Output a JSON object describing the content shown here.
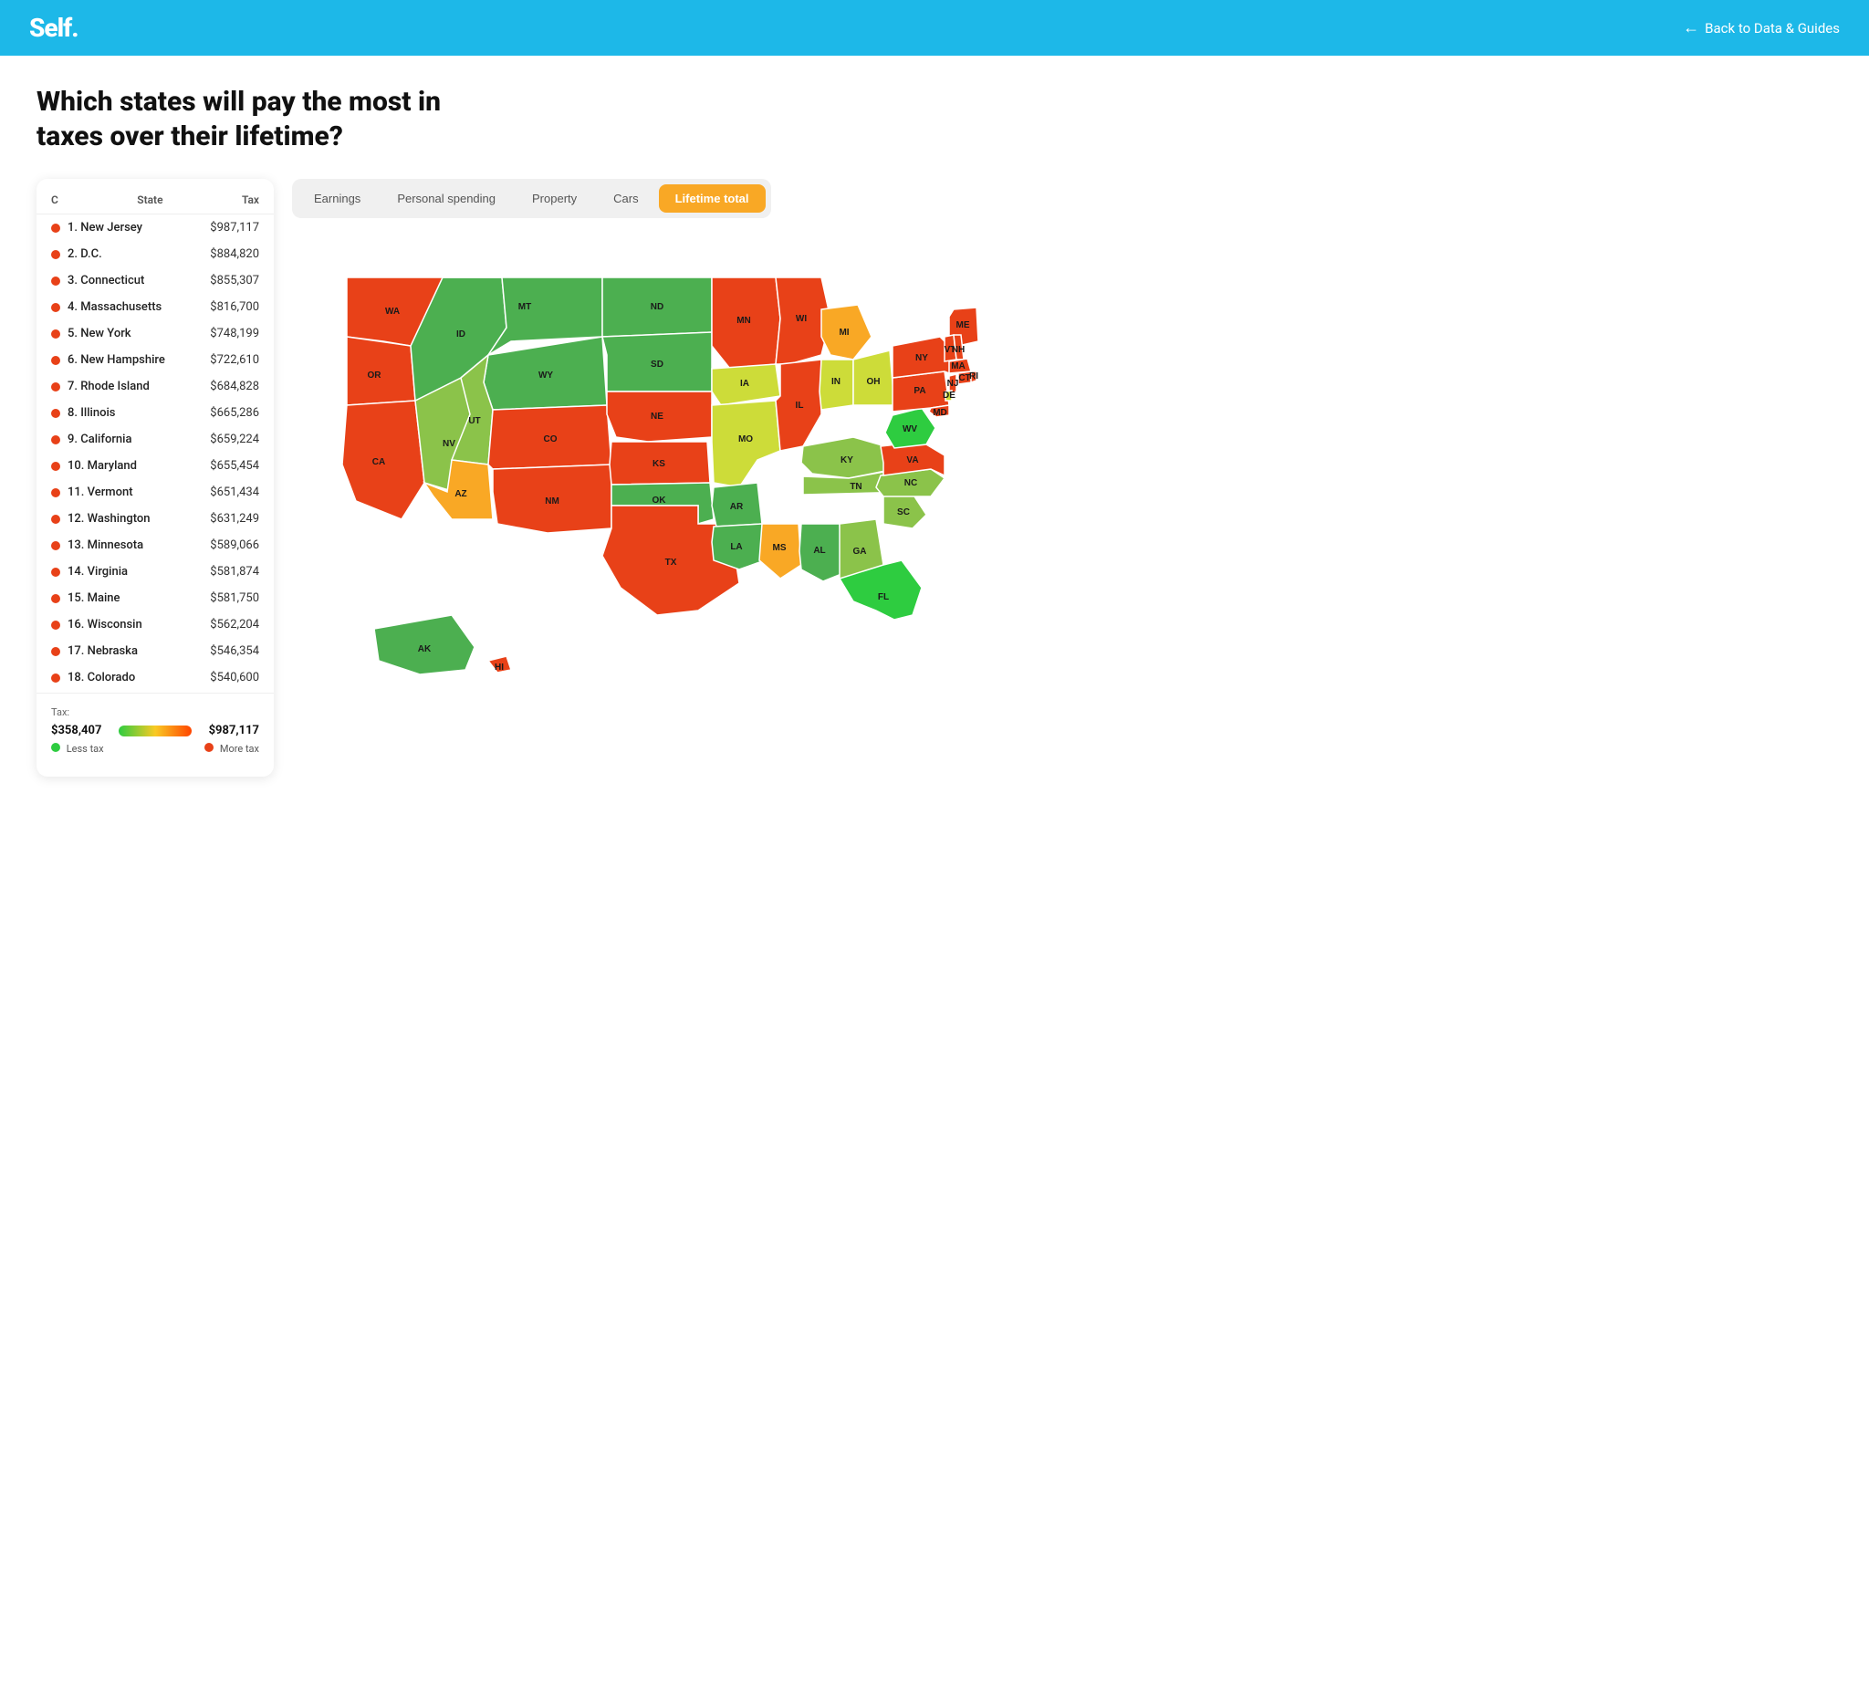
{
  "header": {
    "logo": "Self.",
    "back_label": "Back to Data & Guides"
  },
  "page": {
    "title": "Which states will pay the most in taxes over their lifetime?"
  },
  "tabs": [
    {
      "id": "earnings",
      "label": "Earnings",
      "active": false
    },
    {
      "id": "personal_spending",
      "label": "Personal spending",
      "active": false
    },
    {
      "id": "property",
      "label": "Property",
      "active": false
    },
    {
      "id": "cars",
      "label": "Cars",
      "active": false
    },
    {
      "id": "lifetime_total",
      "label": "Lifetime total",
      "active": true
    }
  ],
  "table": {
    "col_c": "C",
    "col_state": "State",
    "col_tax": "Tax",
    "rows": [
      {
        "rank": "1. New Jersey",
        "tax": "$987,117",
        "color": "#e84118"
      },
      {
        "rank": "2. D.C.",
        "tax": "$884,820",
        "color": "#e84118"
      },
      {
        "rank": "3. Connecticut",
        "tax": "$855,307",
        "color": "#e84118"
      },
      {
        "rank": "4. Massachusetts",
        "tax": "$816,700",
        "color": "#e84118"
      },
      {
        "rank": "5. New York",
        "tax": "$748,199",
        "color": "#e84118"
      },
      {
        "rank": "6. New Hampshire",
        "tax": "$722,610",
        "color": "#e84118"
      },
      {
        "rank": "7. Rhode Island",
        "tax": "$684,828",
        "color": "#e84118"
      },
      {
        "rank": "8. Illinois",
        "tax": "$665,286",
        "color": "#e84118"
      },
      {
        "rank": "9. California",
        "tax": "$659,224",
        "color": "#e84118"
      },
      {
        "rank": "10. Maryland",
        "tax": "$655,454",
        "color": "#e84118"
      },
      {
        "rank": "11. Vermont",
        "tax": "$651,434",
        "color": "#e84118"
      },
      {
        "rank": "12. Washington",
        "tax": "$631,249",
        "color": "#e84118"
      },
      {
        "rank": "13. Minnesota",
        "tax": "$589,066",
        "color": "#e84118"
      },
      {
        "rank": "14. Virginia",
        "tax": "$581,874",
        "color": "#e84118"
      },
      {
        "rank": "15. Maine",
        "tax": "$581,750",
        "color": "#e84118"
      },
      {
        "rank": "16. Wisconsin",
        "tax": "$562,204",
        "color": "#e84118"
      },
      {
        "rank": "17. Nebraska",
        "tax": "$546,354",
        "color": "#e84118"
      },
      {
        "rank": "18. Colorado",
        "tax": "$540,600",
        "color": "#e84118"
      }
    ]
  },
  "legend": {
    "label": "Tax:",
    "min": "$358,407",
    "max": "$987,117",
    "less_tax": "Less tax",
    "more_tax": "More tax"
  },
  "map": {
    "states": {
      "WA": {
        "color": "#e84118",
        "label": "WA"
      },
      "OR": {
        "color": "#e84118",
        "label": "OR"
      },
      "CA": {
        "color": "#e84118",
        "label": "CA"
      },
      "NV": {
        "color": "#8bc34a",
        "label": "NV"
      },
      "ID": {
        "color": "#4caf50",
        "label": "ID"
      },
      "MT": {
        "color": "#4caf50",
        "label": "MT"
      },
      "WY": {
        "color": "#4caf50",
        "label": "WY"
      },
      "UT": {
        "color": "#8bc34a",
        "label": "UT"
      },
      "AZ": {
        "color": "#f9a825",
        "label": "AZ"
      },
      "CO": {
        "color": "#e84118",
        "label": "CO"
      },
      "NM": {
        "color": "#e84118",
        "label": "NM"
      },
      "TX": {
        "color": "#e84118",
        "label": "TX"
      },
      "ND": {
        "color": "#4caf50",
        "label": "ND"
      },
      "SD": {
        "color": "#4caf50",
        "label": "SD"
      },
      "NE": {
        "color": "#e84118",
        "label": "NE"
      },
      "KS": {
        "color": "#e84118",
        "label": "KS"
      },
      "OK": {
        "color": "#4caf50",
        "label": "OK"
      },
      "MN": {
        "color": "#e84118",
        "label": "MN"
      },
      "IA": {
        "color": "#cddc39",
        "label": "IA"
      },
      "MO": {
        "color": "#cddc39",
        "label": "MO"
      },
      "AR": {
        "color": "#4caf50",
        "label": "AR"
      },
      "LA": {
        "color": "#4caf50",
        "label": "LA"
      },
      "WI": {
        "color": "#e84118",
        "label": "WI"
      },
      "IL": {
        "color": "#e84118",
        "label": "IL"
      },
      "MI": {
        "color": "#f9a825",
        "label": "MI"
      },
      "IN": {
        "color": "#cddc39",
        "label": "IN"
      },
      "KY": {
        "color": "#8bc34a",
        "label": "KY"
      },
      "TN": {
        "color": "#8bc34a",
        "label": "TN"
      },
      "MS": {
        "color": "#f9a825",
        "label": "MS"
      },
      "AL": {
        "color": "#4caf50",
        "label": "AL"
      },
      "GA": {
        "color": "#8bc34a",
        "label": "GA"
      },
      "FL": {
        "color": "#2ecc40",
        "label": "FL"
      },
      "SC": {
        "color": "#8bc34a",
        "label": "SC"
      },
      "NC": {
        "color": "#8bc34a",
        "label": "NC"
      },
      "VA": {
        "color": "#e84118",
        "label": "VA"
      },
      "WV": {
        "color": "#2ecc40",
        "label": "WV"
      },
      "OH": {
        "color": "#cddc39",
        "label": "OH"
      },
      "PA": {
        "color": "#e84118",
        "label": "PA"
      },
      "NY": {
        "color": "#e84118",
        "label": "NY"
      },
      "VT": {
        "color": "#e84118",
        "label": "VT"
      },
      "NH": {
        "color": "#e84118",
        "label": "NH"
      },
      "MA": {
        "color": "#e84118",
        "label": "MA"
      },
      "CT": {
        "color": "#e84118",
        "label": "CT"
      },
      "RI": {
        "color": "#e84118",
        "label": "RI"
      },
      "NJ": {
        "color": "#e84118",
        "label": "NJ"
      },
      "DE": {
        "color": "#cddc39",
        "label": "DE"
      },
      "MD": {
        "color": "#e84118",
        "label": "MD"
      },
      "ME": {
        "color": "#e84118",
        "label": "ME"
      },
      "AK": {
        "color": "#4caf50",
        "label": "AK"
      },
      "HI": {
        "color": "#e84118",
        "label": "HI"
      }
    }
  }
}
